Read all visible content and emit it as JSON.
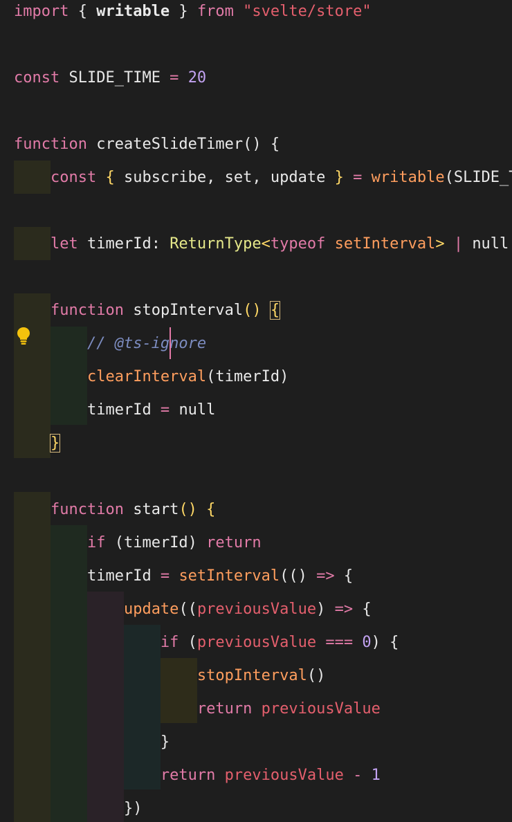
{
  "colors": {
    "background": "#1e1e1e",
    "guide_level1": "#2b2b1d",
    "guide_level2": "#1f2a20",
    "guide_level3": "#2a2228",
    "guide_level4": "#1c2828",
    "guide_level5": "#2e2c1a",
    "bulb": "#f4c20d",
    "cursor": "#e57aa8"
  },
  "icons": {
    "lightbulb": "lightbulb-icon"
  },
  "code": {
    "lines": {
      "l1": [
        {
          "text": "import ",
          "color": "#e27ba8"
        },
        {
          "text": "{ ",
          "color": "#e8e8e8"
        },
        {
          "text": "writable",
          "color": "#eaeaea",
          "bold": true
        },
        {
          "text": " } ",
          "color": "#e8e8e8"
        },
        {
          "text": "from ",
          "color": "#e27ba8"
        },
        {
          "text": "\"svelte/store\"",
          "color": "#e45f6d"
        }
      ],
      "l3": [
        {
          "text": "const ",
          "color": "#e27ba8"
        },
        {
          "text": "SLIDE_TIME",
          "color": "#e8e8e8"
        },
        {
          "text": " = ",
          "color": "#e27ba8"
        },
        {
          "text": "20",
          "color": "#c3a3f2"
        }
      ],
      "l5": [
        {
          "text": "function ",
          "color": "#e27ba8"
        },
        {
          "text": "createSlideTimer",
          "color": "#eaeaea"
        },
        {
          "text": "() {",
          "color": "#e8e8e8"
        }
      ],
      "l6": [
        {
          "text": "    "
        },
        {
          "text": "const ",
          "color": "#e27ba8"
        },
        {
          "text": "{ ",
          "color": "#ffd866"
        },
        {
          "text": "subscribe, set, update ",
          "color": "#e8e8e8"
        },
        {
          "text": "} ",
          "color": "#ffd866"
        },
        {
          "text": "= ",
          "color": "#e27ba8"
        },
        {
          "text": "writable",
          "color": "#ff9e5e"
        },
        {
          "text": "(SLIDE_T",
          "color": "#e8e8e8"
        }
      ],
      "l8": [
        {
          "text": "    "
        },
        {
          "text": "let ",
          "color": "#e27ba8"
        },
        {
          "text": "timerId",
          "color": "#eaeaea"
        },
        {
          "text": ": ",
          "color": "#e8e8e8"
        },
        {
          "text": "ReturnType",
          "color": "#e5e88a"
        },
        {
          "text": "<",
          "color": "#ffd866"
        },
        {
          "text": "typeof ",
          "color": "#e27ba8"
        },
        {
          "text": "setInterval",
          "color": "#ff9e5e"
        },
        {
          "text": "> ",
          "color": "#ffd866"
        },
        {
          "text": "| ",
          "color": "#e27ba8"
        },
        {
          "text": "null",
          "color": "#e8e8e8"
        }
      ],
      "l10": [
        {
          "text": "    "
        },
        {
          "text": "function ",
          "color": "#e27ba8"
        },
        {
          "text": "stopInterval",
          "color": "#eaeaea"
        },
        {
          "text": "() ",
          "color": "#ffd866"
        },
        {
          "text": "{",
          "color": "#ffd866",
          "boxed": true
        }
      ],
      "l11": [
        {
          "text": "        "
        },
        {
          "text": "// @ts-ignore",
          "color": "#7c8cc0",
          "italic": true
        }
      ],
      "l12": [
        {
          "text": "        "
        },
        {
          "text": "clearInterval",
          "color": "#ff9e5e"
        },
        {
          "text": "(timerId)",
          "color": "#e8e8e8"
        }
      ],
      "l13": [
        {
          "text": "        "
        },
        {
          "text": "timerId",
          "color": "#e8e8e8"
        },
        {
          "text": " = ",
          "color": "#e27ba8"
        },
        {
          "text": "null",
          "color": "#e8e8e8"
        }
      ],
      "l14": [
        {
          "text": "    "
        },
        {
          "text": "}",
          "color": "#ffd866",
          "boxed": true
        }
      ],
      "l16": [
        {
          "text": "    "
        },
        {
          "text": "function ",
          "color": "#e27ba8"
        },
        {
          "text": "start",
          "color": "#eaeaea"
        },
        {
          "text": "() {",
          "color": "#ffd866"
        }
      ],
      "l17": [
        {
          "text": "        "
        },
        {
          "text": "if ",
          "color": "#e27ba8"
        },
        {
          "text": "(timerId) ",
          "color": "#e8e8e8"
        },
        {
          "text": "return",
          "color": "#e27ba8"
        }
      ],
      "l18": [
        {
          "text": "        "
        },
        {
          "text": "timerId",
          "color": "#e8e8e8"
        },
        {
          "text": " = ",
          "color": "#e27ba8"
        },
        {
          "text": "setInterval",
          "color": "#ff9e5e"
        },
        {
          "text": "(() ",
          "color": "#e8e8e8"
        },
        {
          "text": "=> ",
          "color": "#e27ba8"
        },
        {
          "text": "{",
          "color": "#e8e8e8"
        }
      ],
      "l19": [
        {
          "text": "            "
        },
        {
          "text": "update",
          "color": "#ff9e5e"
        },
        {
          "text": "((",
          "color": "#e8e8e8"
        },
        {
          "text": "previousValue",
          "color": "#e45f6d"
        },
        {
          "text": ") ",
          "color": "#e8e8e8"
        },
        {
          "text": "=> ",
          "color": "#e27ba8"
        },
        {
          "text": "{",
          "color": "#e8e8e8"
        }
      ],
      "l20": [
        {
          "text": "                "
        },
        {
          "text": "if ",
          "color": "#e27ba8"
        },
        {
          "text": "(",
          "color": "#e8e8e8"
        },
        {
          "text": "previousValue",
          "color": "#e45f6d"
        },
        {
          "text": " === ",
          "color": "#e27ba8"
        },
        {
          "text": "0",
          "color": "#c3a3f2"
        },
        {
          "text": ") {",
          "color": "#e8e8e8"
        }
      ],
      "l21": [
        {
          "text": "                    "
        },
        {
          "text": "stopInterval",
          "color": "#ff9e5e"
        },
        {
          "text": "()",
          "color": "#e8e8e8"
        }
      ],
      "l22": [
        {
          "text": "                    "
        },
        {
          "text": "return ",
          "color": "#e27ba8"
        },
        {
          "text": "previousValue",
          "color": "#e45f6d"
        }
      ],
      "l23": [
        {
          "text": "                "
        },
        {
          "text": "}",
          "color": "#e8e8e8"
        }
      ],
      "l24": [
        {
          "text": "                "
        },
        {
          "text": "return ",
          "color": "#e27ba8"
        },
        {
          "text": "previousValue",
          "color": "#e45f6d"
        },
        {
          "text": " - ",
          "color": "#e27ba8"
        },
        {
          "text": "1",
          "color": "#c3a3f2"
        }
      ],
      "l25": [
        {
          "text": "            "
        },
        {
          "text": "})",
          "color": "#e8e8e8"
        }
      ]
    }
  }
}
